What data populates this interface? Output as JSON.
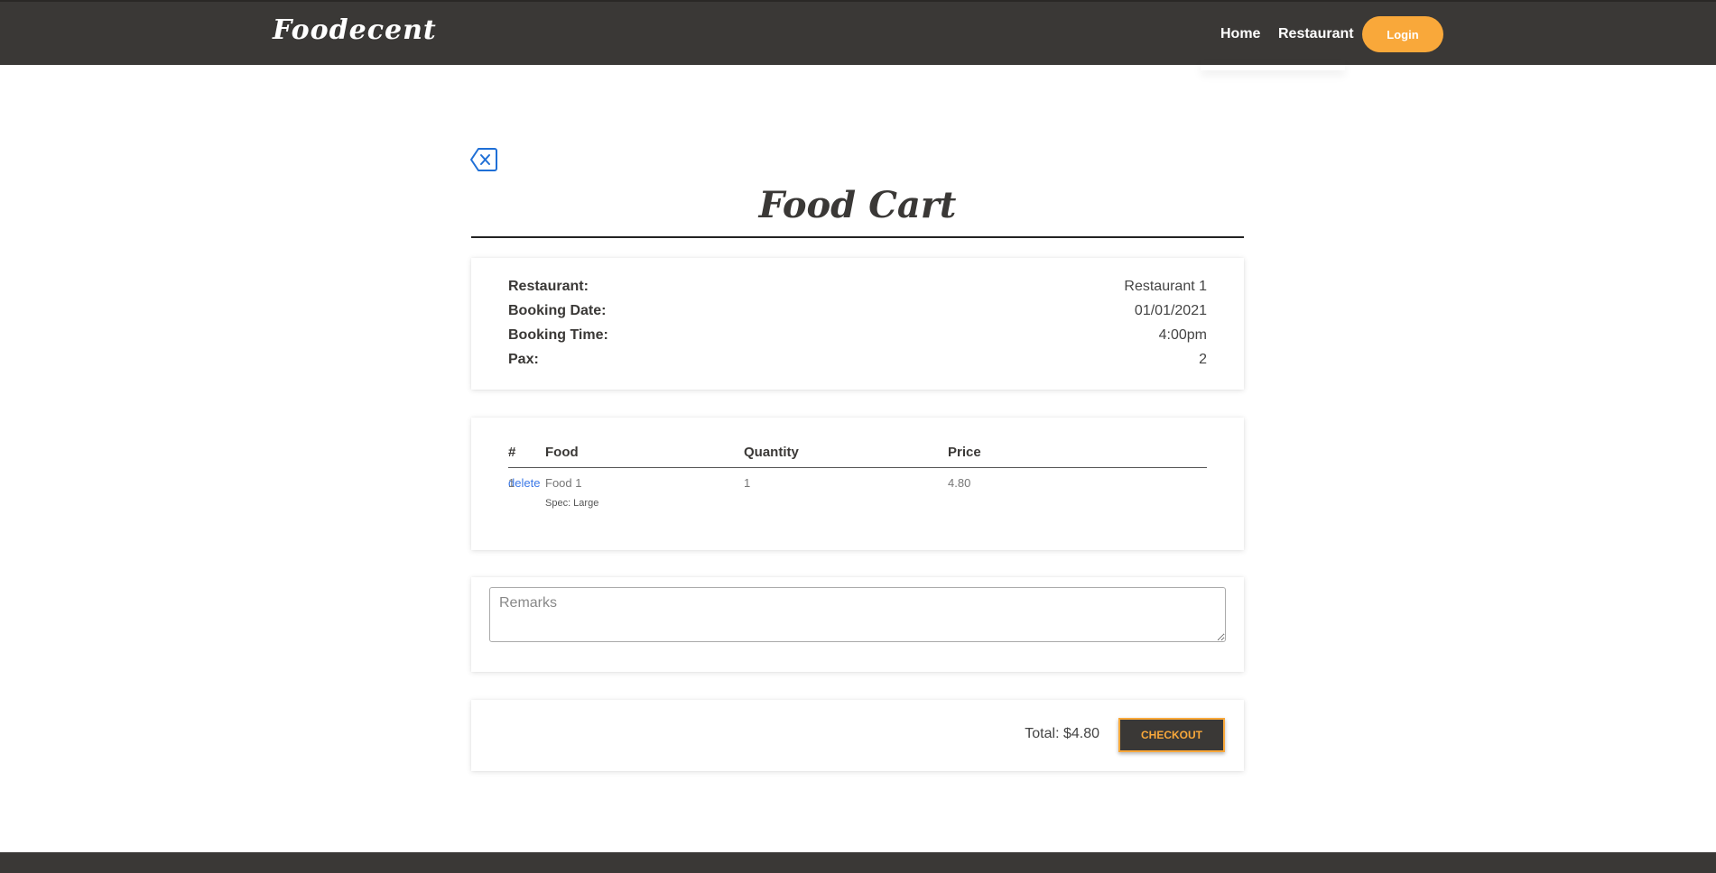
{
  "nav": {
    "brand": "Foodecent",
    "links": [
      "Home",
      "Restaurant"
    ],
    "login_label": "Login"
  },
  "page": {
    "title": "Food Cart",
    "back_icon": "backspace-x-icon"
  },
  "booking": {
    "rows": [
      {
        "label": "Restaurant:",
        "value": "Restaurant 1"
      },
      {
        "label": "Booking Date:",
        "value": "01/01/2021"
      },
      {
        "label": "Booking Time:",
        "value": "4:00pm"
      },
      {
        "label": "Pax:",
        "value": "2"
      }
    ]
  },
  "items": {
    "headers": [
      "#",
      "Food",
      "Quantity",
      "Price"
    ],
    "rows": [
      {
        "num": "1",
        "food": "Food 1",
        "spec": "Spec: Large",
        "quantity": "1",
        "price": "4.80",
        "action": "delete"
      }
    ]
  },
  "remarks": {
    "placeholder": "Remarks",
    "value": ""
  },
  "summary": {
    "total": "Total: $4.80",
    "checkout_label": "CHECKOUT"
  },
  "colors": {
    "header_bg": "#3a3836",
    "accent": "#f9a83a",
    "link": "#3b78e7"
  }
}
